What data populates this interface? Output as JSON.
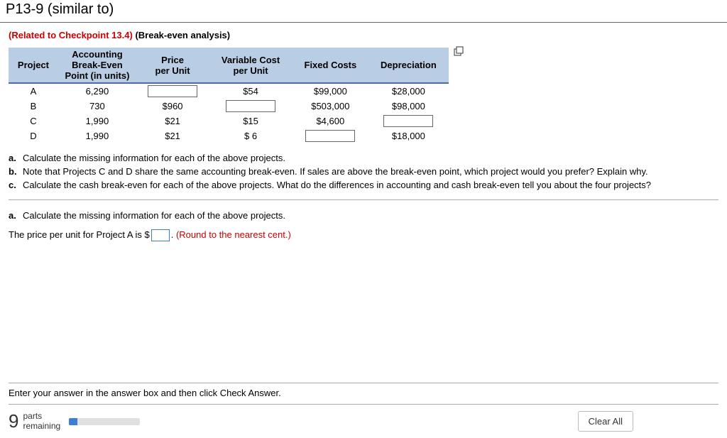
{
  "header": {
    "title": "P13-9 (similar to)"
  },
  "related": {
    "red": "(Related to Checkpoint 13.4)",
    "black": "(Break-even analysis)"
  },
  "table": {
    "headers": {
      "project": "Project",
      "abep": "Accounting Break-Even Point (in units)",
      "price": "Price per Unit",
      "varcost": "Variable Cost per Unit",
      "fixed": "Fixed Costs",
      "depr": "Depreciation"
    },
    "rows": [
      {
        "project": "A",
        "abep": "6,290",
        "price": "",
        "varcost": "$54",
        "fixed": "$99,000",
        "depr": "$28,000"
      },
      {
        "project": "B",
        "abep": "730",
        "price": "$960",
        "varcost": "",
        "fixed": "$503,000",
        "depr": "$98,000"
      },
      {
        "project": "C",
        "abep": "1,990",
        "price": "$21",
        "varcost": "$15",
        "fixed": "$4,600",
        "depr": ""
      },
      {
        "project": "D",
        "abep": "1,990",
        "price": "$21",
        "varcost": "$ 6",
        "fixed": "",
        "depr": "$18,000"
      }
    ]
  },
  "questions": {
    "a": "Calculate the missing information for each of the above projects.",
    "b": "Note that Projects C and D share the same accounting break-even.  If sales are above the break-even point, which project would you prefer?  Explain why.",
    "c": "Calculate the cash break-even for each of the above projects.  What do the differences in accounting and cash break-even tell you about the four projects?"
  },
  "current": {
    "label": "a.",
    "text": "Calculate the missing information for each of the above projects.",
    "prompt_pre": "The price per unit for Project A is $",
    "prompt_post": ".  ",
    "hint": "(Round to the nearest cent.)"
  },
  "footer": {
    "hint": "Enter your answer in the answer box and then click Check Answer.",
    "parts_count": "9",
    "parts_word": "parts",
    "remaining_word": "remaining",
    "clear": "Clear All"
  }
}
